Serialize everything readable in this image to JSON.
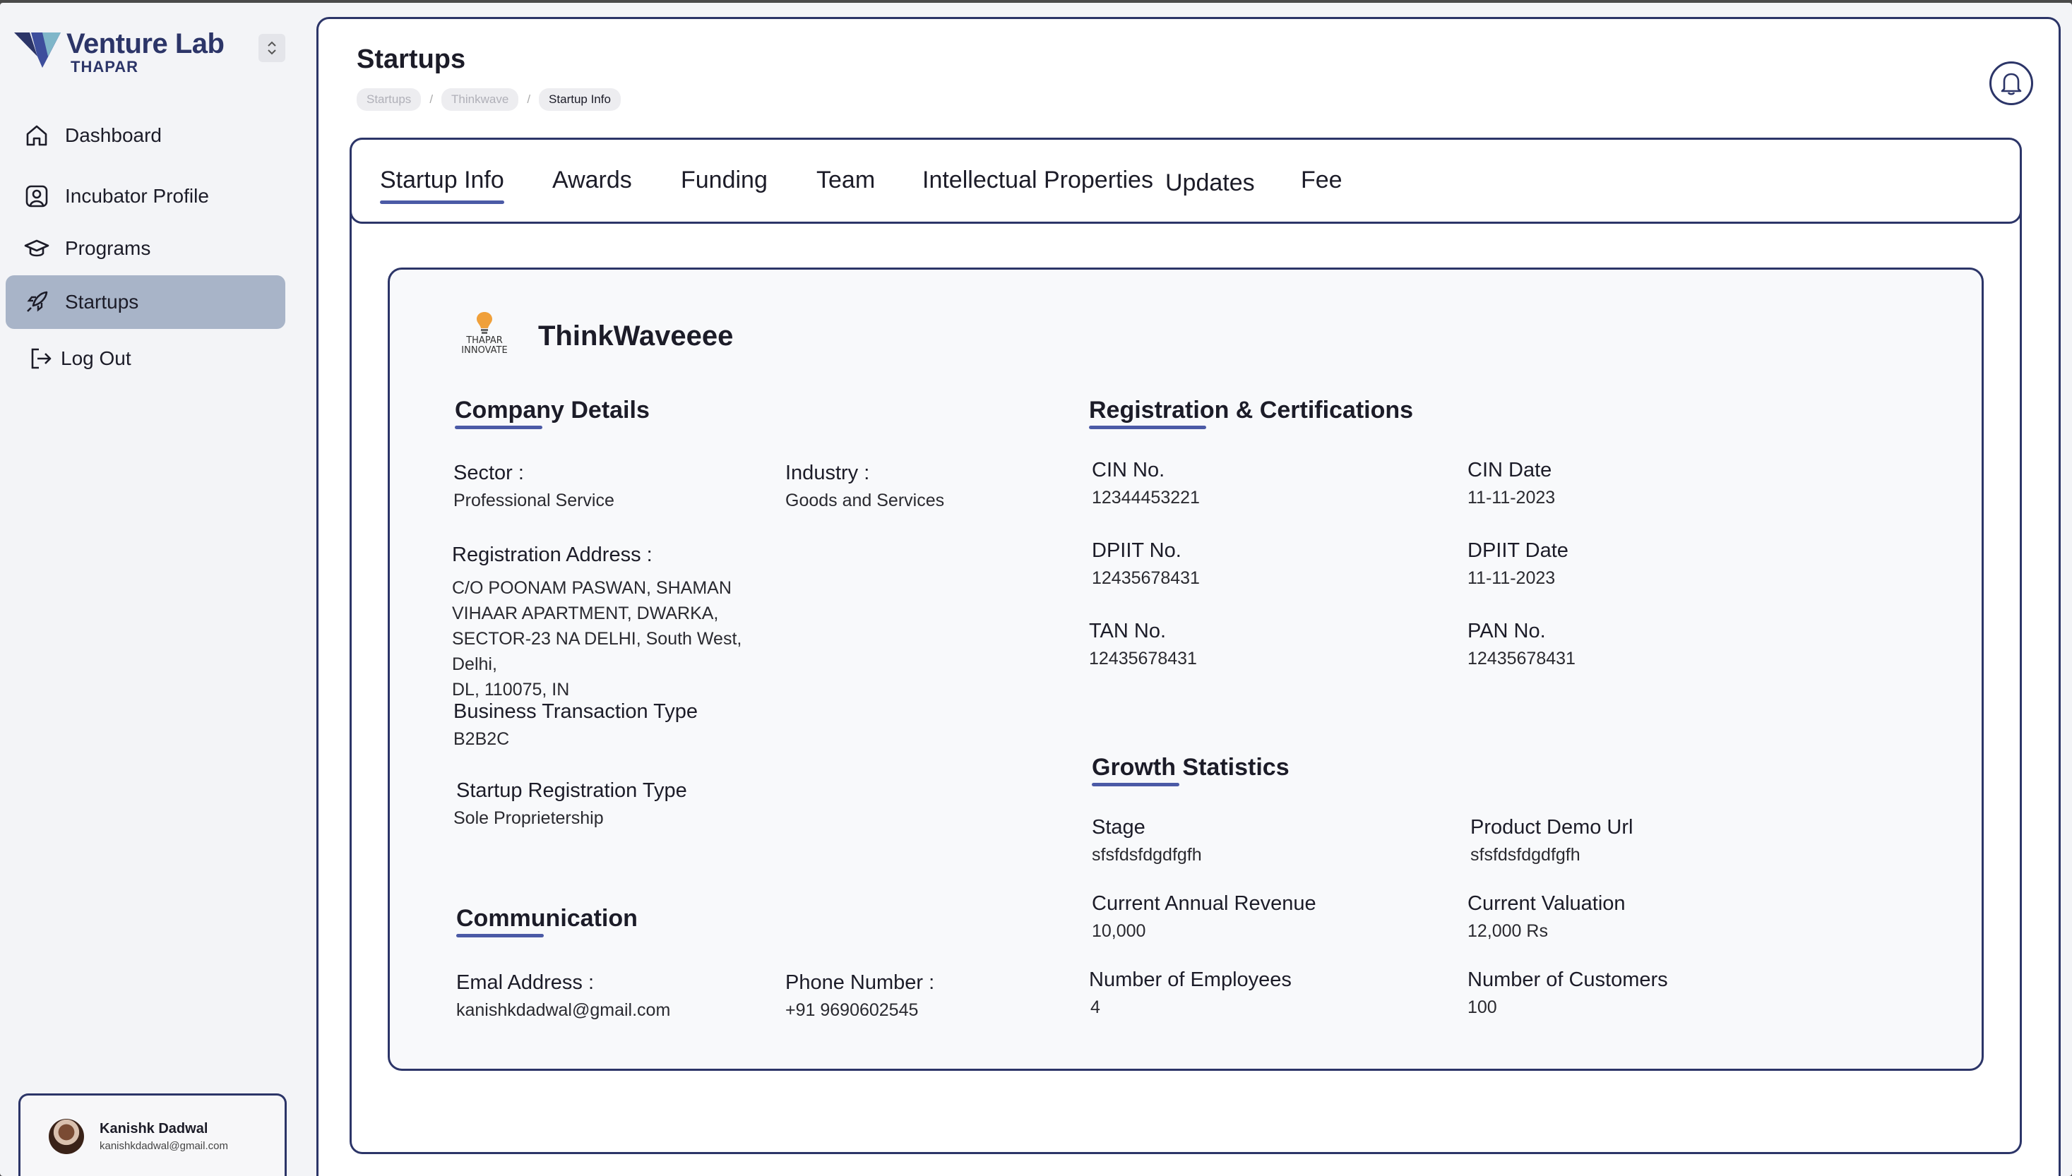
{
  "brand": {
    "name": "Venture Lab",
    "sub": "THAPAR"
  },
  "sidebar": {
    "items": [
      {
        "label": "Dashboard",
        "icon": "home-icon",
        "active": false
      },
      {
        "label": "Incubator  Profile",
        "icon": "user-square-icon",
        "active": false
      },
      {
        "label": "Programs",
        "icon": "graduation-cap-icon",
        "active": false
      },
      {
        "label": "Startups",
        "icon": "rocket-icon",
        "active": true
      },
      {
        "label": "Log Out",
        "icon": "logout-icon",
        "active": false
      }
    ]
  },
  "user": {
    "name": "Kanishk Dadwal",
    "email": "kanishkdadwal@gmail.com"
  },
  "header": {
    "title": "Startups",
    "breadcrumb": [
      "Startups",
      "Thinkwave",
      "Startup Info"
    ]
  },
  "tabs": [
    "Startup Info",
    "Awards",
    "Funding",
    "Team",
    "Intellectual Properties",
    "Updates",
    "Fee"
  ],
  "startup": {
    "logo_text_1": "THAPAR",
    "logo_text_2": "INNOVATE",
    "name": "ThinkWaveeee"
  },
  "company": {
    "title": "Company Details",
    "sector_label": "Sector :",
    "sector": "Professional Service",
    "industry_label": "Industry :",
    "industry": "Goods and Services",
    "address_label": "Registration Address :",
    "address_lines": [
      "C/O POONAM PASWAN, SHAMAN",
      "VIHAAR APARTMENT, DWARKA,",
      "SECTOR-23 NA DELHI, South West, Delhi,",
      "DL, 110075, IN"
    ],
    "btt_label": "Business Transaction Type",
    "btt": "B2B2C",
    "srt_label": "Startup Registration Type",
    "srt": "Sole Proprietership"
  },
  "communication": {
    "title": "Communication",
    "email_label": "Emal Address :",
    "email": "kanishkdadwal@gmail.com",
    "phone_label": "Phone Number :",
    "phone": "+91 9690602545"
  },
  "registration": {
    "title": "Registration & Certifications",
    "cin_label": "CIN No.",
    "cin": "12344453221",
    "cin_date_label": "CIN Date",
    "cin_date": "11-11-2023",
    "dpiit_label": "DPIIT No.",
    "dpiit": "12435678431",
    "dpiit_date_label": "DPIIT Date",
    "dpiit_date": "11-11-2023",
    "tan_label": "TAN No.",
    "tan": "12435678431",
    "pan_label": "PAN No.",
    "pan": "12435678431"
  },
  "growth": {
    "title": "Growth Statistics",
    "stage_label": "Stage",
    "stage": "sfsfdsfdgdfgfh",
    "demo_label": "Product Demo Url",
    "demo": "sfsfdsfdgdfgfh",
    "revenue_label": "Current Annual Revenue",
    "revenue": "10,000",
    "valuation_label": "Current Valuation",
    "valuation": "12,000 Rs",
    "employees_label": "Number of Employees",
    "employees": "4",
    "customers_label": "Number of Customers",
    "customers": "100"
  },
  "colors": {
    "navy": "#2c3568",
    "accent": "#4b5aa6",
    "active_nav": "#a8b4c8"
  }
}
